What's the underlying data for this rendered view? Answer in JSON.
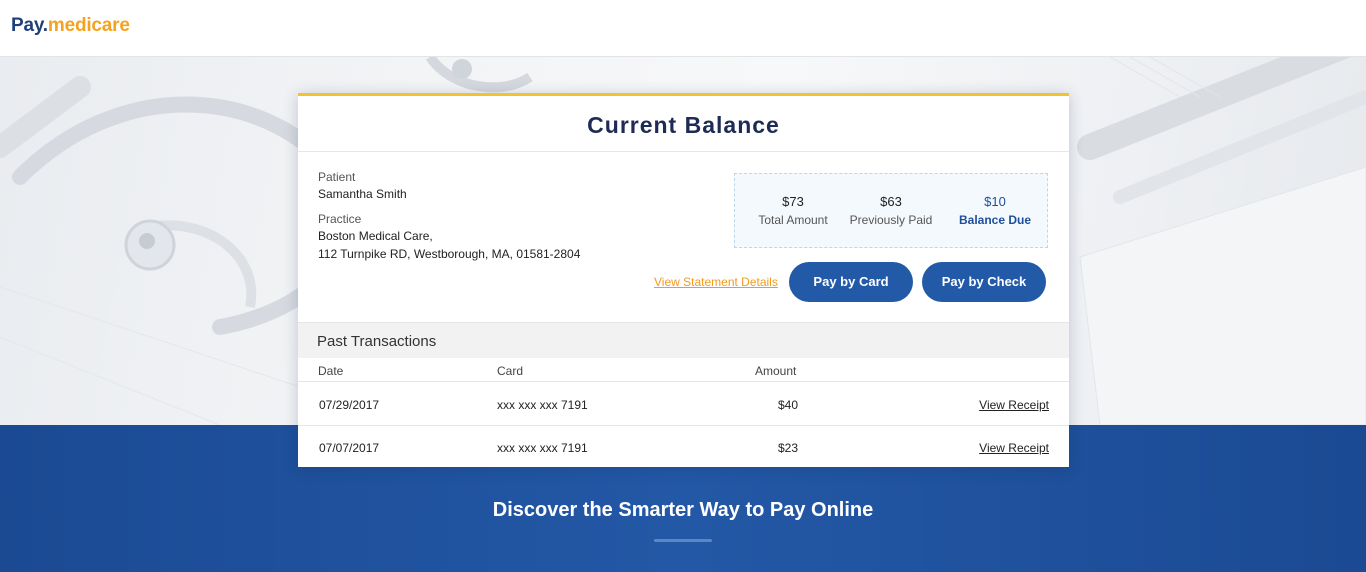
{
  "header": {
    "logo_pay": "Pay.",
    "logo_medicare": "medicare"
  },
  "card": {
    "title": "Current Balance",
    "patient_label": "Patient",
    "patient_name": "Samantha Smith",
    "practice_label": "Practice",
    "practice_name": "Boston Medical Care,",
    "practice_address": "112 Turnpike RD, Westborough, MA, 01581-2804",
    "summary": {
      "total_amount": "$73",
      "total_amount_label": "Total Amount",
      "previously_paid": "$63",
      "previously_paid_label": "Previously Paid",
      "balance_due": "$10",
      "balance_due_label": "Balance Due"
    },
    "view_statement_label": "View Statement Details",
    "pay_card_label": "Pay by Card",
    "pay_check_label": "Pay by Check"
  },
  "past": {
    "title": "Past Transactions",
    "columns": [
      "Date",
      "Card",
      "Amount"
    ],
    "rows": [
      {
        "date": "07/29/2017",
        "card": "xxx xxx xxx 7191",
        "amount": "$40",
        "action": "View Receipt"
      },
      {
        "date": "07/07/2017",
        "card": "xxx xxx xxx 7191",
        "amount": "$23",
        "action": "View Receipt"
      }
    ]
  },
  "band": {
    "title": "Discover the Smarter Way to Pay Online"
  },
  "colors": {
    "brand_blue": "#1f3f7a",
    "brand_orange": "#f3a321",
    "button_blue": "#225aa8",
    "accent_yellow": "#f4c12f",
    "band_blue": "#2358a6"
  }
}
